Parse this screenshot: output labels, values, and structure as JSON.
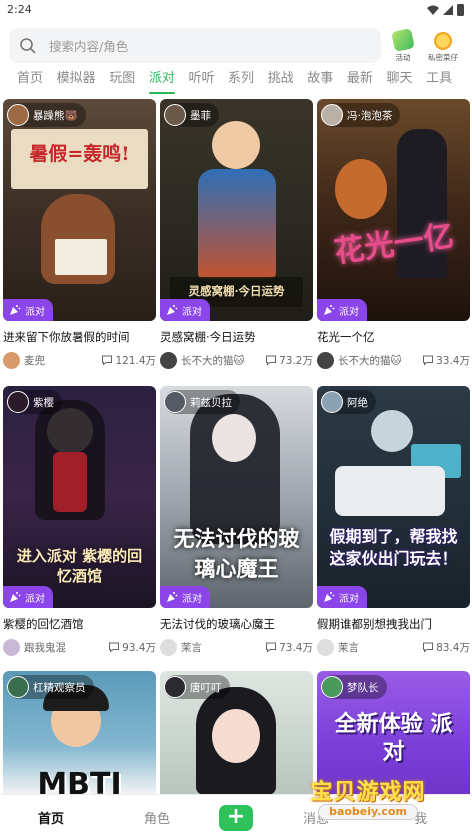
{
  "status_bar": {
    "time": "2:24",
    "icons": [
      "wifi-icon",
      "signal-icon",
      "battery-icon"
    ]
  },
  "search": {
    "placeholder": "搜索内容/角色",
    "icon": "search-icon"
  },
  "top_actions": [
    {
      "label": "活动",
      "icon": "activity-icon"
    },
    {
      "label": "私密菜仔",
      "icon": "custom-icon"
    }
  ],
  "tabs": [
    "首页",
    "模拟器",
    "玩图",
    "派对",
    "听听",
    "系列",
    "挑战",
    "故事",
    "最新",
    "聊天",
    "工具"
  ],
  "active_tab": "派对",
  "accent_color": "#2fb858",
  "badge_color": "#8b45e8",
  "cards": [
    {
      "author": "暴躁熊🐻",
      "art_text": "暑假=轰鸣!",
      "badge": "派对",
      "title": "进来留下你放暑假的时间",
      "user": "麦兜",
      "count": "121.4万"
    },
    {
      "author": "墨菲",
      "art_text": "灵感窝棚·今日运势",
      "badge": "派对",
      "title": "灵感窝棚·今日运势",
      "user": "长不大的猫🐱",
      "count": "73.2万"
    },
    {
      "author": "冯·泡泡茶",
      "art_text": "花光一亿",
      "badge": "派对",
      "title": "花光一个亿",
      "user": "长不大的猫🐱",
      "count": "33.4万"
    },
    {
      "author": "紫樱",
      "art_text": "进入派对 紫樱的回忆酒馆",
      "badge": "派对",
      "title": "紫樱的回忆酒馆",
      "user": "跟我鬼混",
      "count": "93.4万"
    },
    {
      "author": "莉兹贝拉",
      "art_text": "无法讨伐的玻璃心魔王",
      "badge": "派对",
      "title": "无法讨伐的玻璃心魔王",
      "user": "茉言",
      "count": "73.4万"
    },
    {
      "author": "阿绝",
      "art_text": "假期到了，帮我找这家伙出门玩去！",
      "badge": "派对",
      "title": "假期谁都别想拽我出门",
      "user": "茉言",
      "count": "83.4万"
    },
    {
      "author": "杠精观察员",
      "art_text": "MBTI",
      "badge": "",
      "title": "",
      "user": "",
      "count": ""
    },
    {
      "author": "唐叮叮",
      "art_text": "",
      "badge": "",
      "title": "",
      "user": "",
      "count": ""
    },
    {
      "author": "梦队长",
      "art_text": "全新体验 派对",
      "badge": "",
      "title": "",
      "user": "",
      "count": ""
    }
  ],
  "bottom_nav": {
    "home": "首页",
    "role": "角色",
    "plus": "+",
    "msg": "消息",
    "me": "我"
  },
  "watermark": {
    "text": "宝贝游戏网",
    "url": "baobeiy.com"
  }
}
